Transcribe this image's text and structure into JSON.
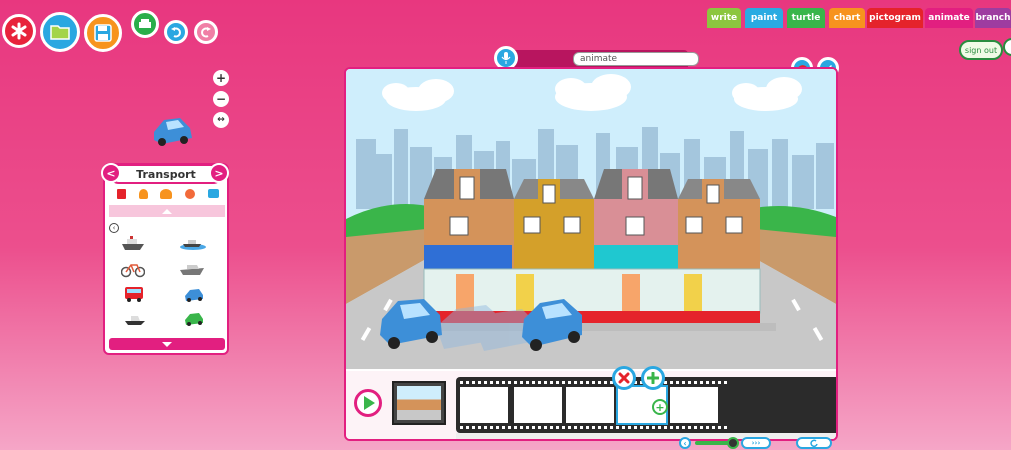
{
  "toolbar": {
    "new_icon": "asterisk-icon",
    "open_icon": "folder-icon",
    "save_icon": "floppy-disk-icon",
    "print_icon": "printer-icon",
    "undo_icon": "undo-icon",
    "redo_icon": "redo-icon"
  },
  "app_tabs": [
    {
      "label": "write",
      "color": "#8cc63f"
    },
    {
      "label": "paint",
      "color": "#29abe2"
    },
    {
      "label": "turtle",
      "color": "#39b54a"
    },
    {
      "label": "chart",
      "color": "#f7931e"
    },
    {
      "label": "pictogram",
      "color": "#e5232b"
    },
    {
      "label": "animate",
      "color": "#e21f80"
    },
    {
      "label": "branch",
      "color": "#9e3ca0"
    }
  ],
  "account": {
    "signout_label": "sign out"
  },
  "zoom": {
    "in": "+",
    "out": "−",
    "fit": "↔"
  },
  "panel": {
    "title": "Transport",
    "prev": "<",
    "next": ">",
    "categories": [
      "book-icon",
      "person-icon",
      "people-icon",
      "ball-icon",
      "camera-icon"
    ],
    "items": [
      "ship",
      "motorboat",
      "bicycle",
      "speedboat",
      "bus",
      "car-blue",
      "jetski",
      "car-green"
    ]
  },
  "stage": {
    "title_value": "animate",
    "mic_icon": "microphone-icon",
    "tool1_icon": "paint-stroke-icon",
    "tool2_icon": "pen-icon"
  },
  "timeline": {
    "play_icon": "play-icon",
    "delete_icon": "close-icon",
    "add_icon": "plus-icon",
    "frame_count": 5,
    "speed_left": "‹",
    "speed_right": "›››",
    "loop_icon": "refresh-icon"
  },
  "colors": {
    "accent": "#e21f80",
    "sky": "#cfeefc",
    "grass": "#3ab54a",
    "road": "#c8c8c8"
  }
}
